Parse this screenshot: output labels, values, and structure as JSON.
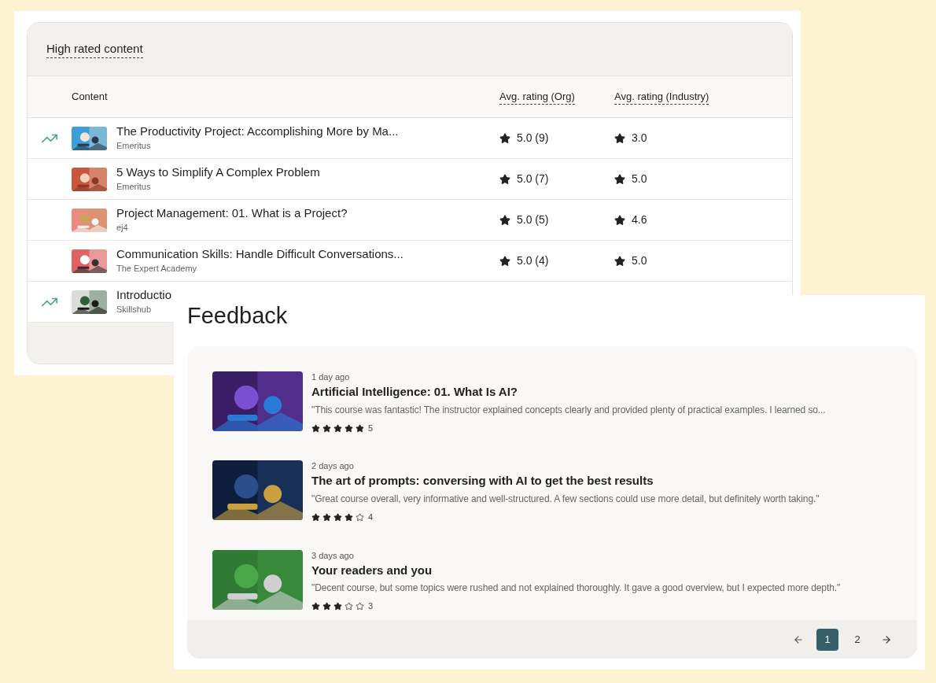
{
  "high_rated": {
    "title": "High rated content",
    "columns": [
      "Content",
      "Avg. rating (Org)",
      "Avg. rating (Industry)"
    ],
    "rows": [
      {
        "trending": true,
        "title": "The Productivity Project: Accomplishing More by Ma...",
        "provider": "Emeritus",
        "org_rating": "5.0 (9)",
        "industry_rating": "3.0"
      },
      {
        "trending": false,
        "title": "5 Ways to Simplify A Complex Problem",
        "provider": "Emeritus",
        "org_rating": "5.0 (7)",
        "industry_rating": "5.0"
      },
      {
        "trending": false,
        "title": "Project Management: 01. What is a Project?",
        "provider": "ej4",
        "org_rating": "5.0 (5)",
        "industry_rating": "4.6"
      },
      {
        "trending": false,
        "title": "Communication Skills: Handle Difficult Conversations...",
        "provider": "The Expert Academy",
        "org_rating": "5.0 (4)",
        "industry_rating": "5.0"
      },
      {
        "trending": true,
        "title": "Introductio",
        "provider": "Skillshub"
      }
    ]
  },
  "feedback": {
    "title": "Feedback",
    "items": [
      {
        "time": "1 day ago",
        "title": "Artificial Intelligence: 01. What Is AI?",
        "comment": "\"This course was fantastic! The instructor explained concepts clearly and provided plenty of practical examples. I learned so...",
        "stars": 5,
        "score": "5"
      },
      {
        "time": "2 days ago",
        "title": "The art of prompts: conversing with AI to get the best results",
        "comment": "\"Great course overall, very informative and well-structured. A few sections could use more detail, but definitely worth taking.\"",
        "stars": 4,
        "score": "4"
      },
      {
        "time": "3 days ago",
        "title": "Your readers and you",
        "comment": "\"Decent course, but some topics were rushed and not explained thoroughly. It gave a good overview, but I expected more depth.\"",
        "stars": 3,
        "score": "3"
      }
    ],
    "pages": [
      {
        "label": "1",
        "selected": true
      },
      {
        "label": "2",
        "selected": false
      }
    ]
  }
}
